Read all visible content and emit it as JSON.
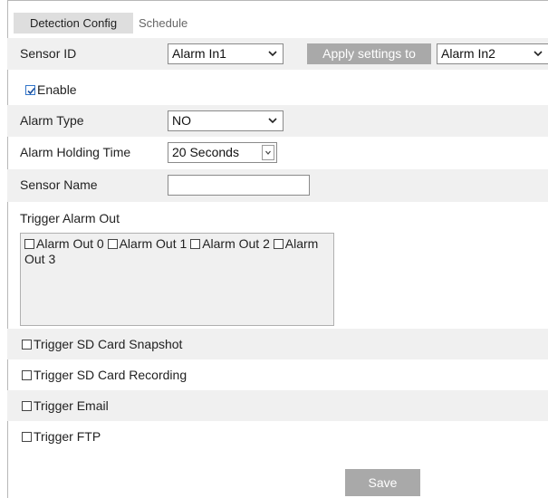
{
  "tabs": [
    {
      "label": "Detection Config",
      "active": true
    },
    {
      "label": "Schedule",
      "active": false
    }
  ],
  "sensor_id": {
    "label": "Sensor ID",
    "value": "Alarm In1"
  },
  "apply_settings": {
    "label": "Apply settings to",
    "value": "Alarm In2"
  },
  "enable": {
    "label": "Enable",
    "checked": true
  },
  "alarm_type": {
    "label": "Alarm Type",
    "value": "NO"
  },
  "holding_time": {
    "label": "Alarm Holding Time",
    "value": "20 Seconds"
  },
  "sensor_name": {
    "label": "Sensor Name",
    "value": ""
  },
  "trigger_alarm_out": {
    "label": "Trigger Alarm Out",
    "outputs": [
      {
        "label": "Alarm Out 0",
        "checked": false
      },
      {
        "label": "Alarm Out 1",
        "checked": false
      },
      {
        "label": "Alarm Out 2",
        "checked": false
      },
      {
        "label": "Alarm Out 3",
        "checked": false
      }
    ]
  },
  "triggers": [
    {
      "label": "Trigger SD Card Snapshot",
      "checked": false
    },
    {
      "label": "Trigger SD Card Recording",
      "checked": false
    },
    {
      "label": "Trigger Email",
      "checked": false
    },
    {
      "label": "Trigger FTP",
      "checked": false
    }
  ],
  "save_label": "Save",
  "colors": {
    "row_gray": "#f0f0f0",
    "button_gray": "#a9a9a9",
    "check_blue": "#3275c9"
  }
}
